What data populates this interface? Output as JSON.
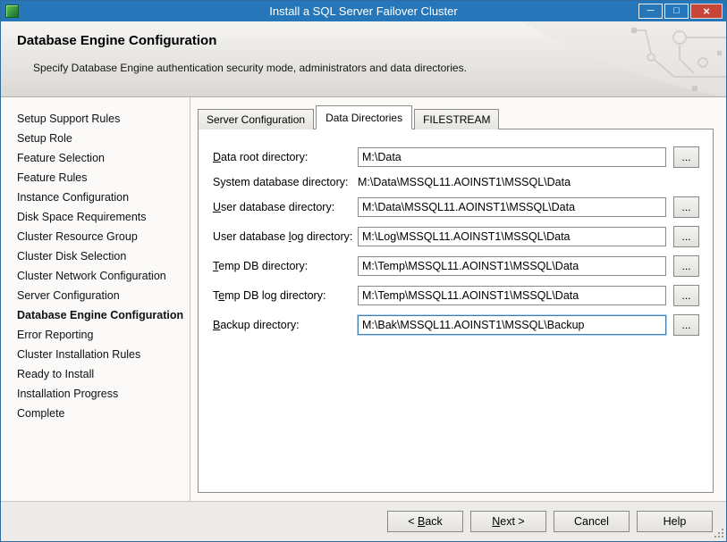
{
  "window": {
    "title": "Install a SQL Server Failover Cluster",
    "controls": {
      "minimize_icon": "─",
      "maximize_icon": "□",
      "close_icon": "×"
    }
  },
  "header": {
    "title": "Database Engine Configuration",
    "subtitle": "Specify Database Engine authentication security mode, administrators and data directories."
  },
  "sidebar": {
    "items": [
      {
        "label": "Setup Support Rules",
        "active": false
      },
      {
        "label": "Setup Role",
        "active": false
      },
      {
        "label": "Feature Selection",
        "active": false
      },
      {
        "label": "Feature Rules",
        "active": false
      },
      {
        "label": "Instance Configuration",
        "active": false
      },
      {
        "label": "Disk Space Requirements",
        "active": false
      },
      {
        "label": "Cluster Resource Group",
        "active": false
      },
      {
        "label": "Cluster Disk Selection",
        "active": false
      },
      {
        "label": "Cluster Network Configuration",
        "active": false
      },
      {
        "label": "Server Configuration",
        "active": false
      },
      {
        "label": "Database Engine Configuration",
        "active": true
      },
      {
        "label": "Error Reporting",
        "active": false
      },
      {
        "label": "Cluster Installation Rules",
        "active": false
      },
      {
        "label": "Ready to Install",
        "active": false
      },
      {
        "label": "Installation Progress",
        "active": false
      },
      {
        "label": "Complete",
        "active": false
      }
    ]
  },
  "tabs": [
    {
      "label": "Server Configuration",
      "active": false
    },
    {
      "label": "Data Directories",
      "active": true
    },
    {
      "label": "FILESTREAM",
      "active": false
    }
  ],
  "form": {
    "browse_label": "...",
    "fields": [
      {
        "label": "&Data root directory:",
        "value": "M:\\Data",
        "type": "input"
      },
      {
        "label": "System database directory:",
        "value": "M:\\Data\\MSSQL11.AOINST1\\MSSQL\\Data",
        "type": "static"
      },
      {
        "label": "&User database directory:",
        "value": "M:\\Data\\MSSQL11.AOINST1\\MSSQL\\Data",
        "type": "input"
      },
      {
        "label": "User database &log directory:",
        "value": "M:\\Log\\MSSQL11.AOINST1\\MSSQL\\Data",
        "type": "input"
      },
      {
        "label": "&Temp DB directory:",
        "value": "M:\\Temp\\MSSQL11.AOINST1\\MSSQL\\Data",
        "type": "input"
      },
      {
        "label": "T&emp DB log directory:",
        "value": "M:\\Temp\\MSSQL11.AOINST1\\MSSQL\\Data",
        "type": "input"
      },
      {
        "label": "&Backup directory:",
        "value": "M:\\Bak\\MSSQL11.AOINST1\\MSSQL\\Backup",
        "type": "input",
        "focused": true
      }
    ]
  },
  "footer": {
    "buttons": [
      {
        "label": "< &Back"
      },
      {
        "label": "&Next >"
      },
      {
        "label": "Cancel"
      },
      {
        "label": "Help"
      }
    ]
  },
  "colors": {
    "titlebar": "#2577b9",
    "close_button": "#c8453a",
    "focus_border": "#3c7fb1"
  }
}
